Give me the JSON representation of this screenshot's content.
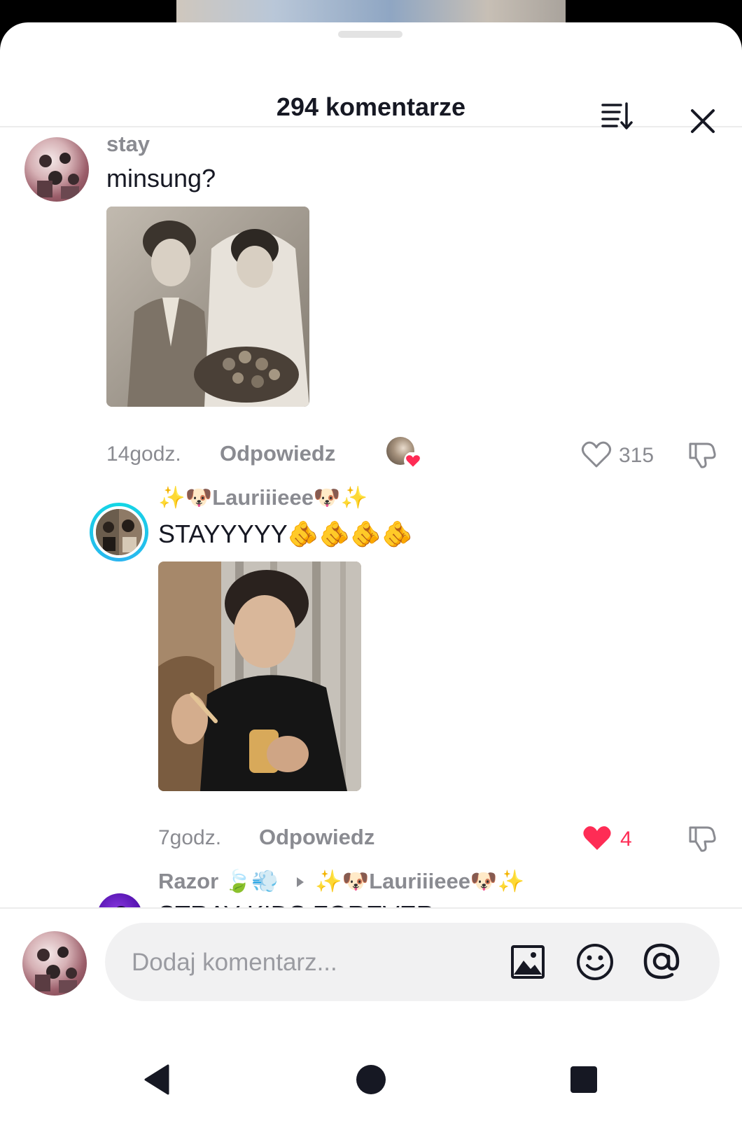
{
  "header": {
    "title": "294 komentarze"
  },
  "comments": [
    {
      "username": "stay",
      "text": "minsung?",
      "time": "14godz.",
      "reply_label": "Odpowiedz",
      "likes": "315",
      "liked": false
    },
    {
      "username": "✨🐶Lauriiieee🐶✨",
      "text": "STAYYYYY🫵🫵🫵🫵",
      "time": "7godz.",
      "reply_label": "Odpowiedz",
      "likes": "4",
      "liked": true
    },
    {
      "username": "Razor 🍃💨",
      "reply_to": "✨🐶Lauriiieee🐶✨",
      "text": "STRAY KIDS FOREVER"
    }
  ],
  "composer": {
    "placeholder": "Dodaj komentarz..."
  },
  "icons": {
    "sort": "sort-icon",
    "close": "close-icon",
    "heart": "heart-icon",
    "dislike": "dislike-icon",
    "image": "image-icon",
    "emoji": "emoji-icon",
    "mention": "at-icon",
    "back": "back-icon",
    "home": "home-icon",
    "recents": "recents-icon"
  },
  "colors": {
    "accent": "#fe2c55",
    "ring": "#13d7e4"
  }
}
